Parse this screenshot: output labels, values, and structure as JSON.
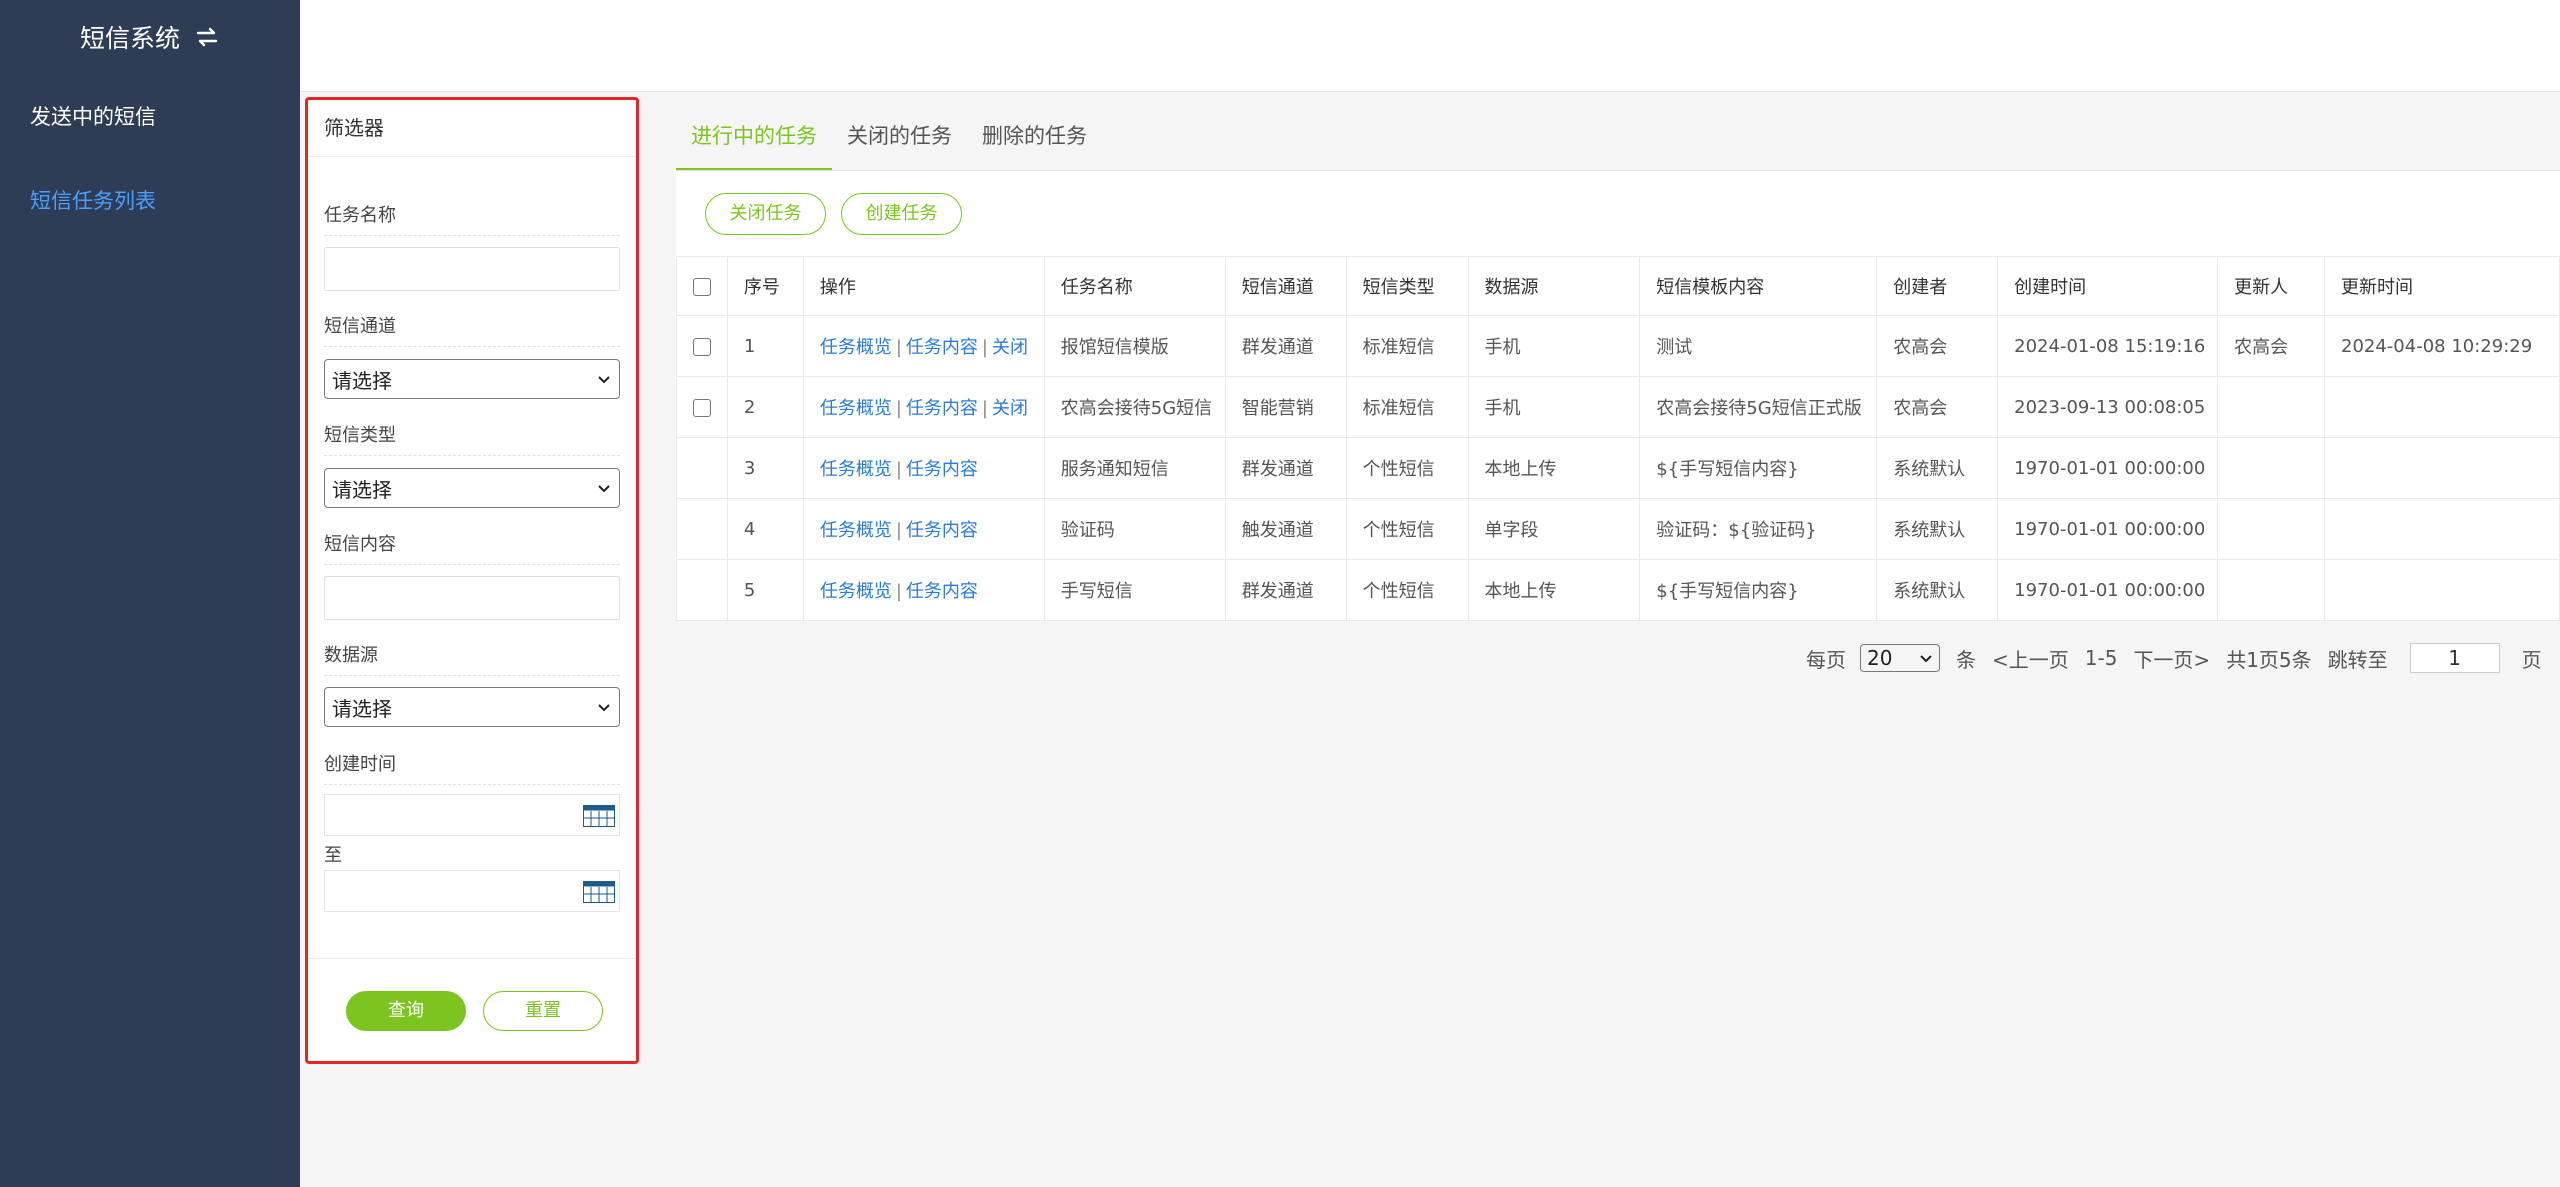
{
  "sidebar": {
    "brand_title": "短信系统",
    "items": [
      {
        "label": "发送中的短信"
      },
      {
        "label": "短信任务列表"
      }
    ]
  },
  "filter": {
    "title": "筛选器",
    "task_name_label": "任务名称",
    "channel_label": "短信通道",
    "channel_value": "请选择",
    "type_label": "短信类型",
    "type_value": "请选择",
    "content_label": "短信内容",
    "source_label": "数据源",
    "source_value": "请选择",
    "created_label": "创建时间",
    "to_label": "至",
    "query_label": "查询",
    "reset_label": "重置"
  },
  "tabs": [
    {
      "label": "进行中的任务"
    },
    {
      "label": "关闭的任务"
    },
    {
      "label": "删除的任务"
    }
  ],
  "toolbar": {
    "close_task_label": "关闭任务",
    "create_task_label": "创建任务"
  },
  "table": {
    "headers": [
      "序号",
      "操作",
      "任务名称",
      "短信通道",
      "短信类型",
      "数据源",
      "短信模板内容",
      "创建者",
      "创建时间",
      "更新人",
      "更新时间"
    ],
    "op_overview": "任务概览",
    "op_content": "任务内容",
    "op_close": "关闭",
    "op_sep": "|",
    "rows": [
      {
        "no": "1",
        "name": "报馆短信模版",
        "channel": "群发通道",
        "type": "标准短信",
        "source": "手机",
        "template": "测试",
        "creator": "农高会",
        "created": "2024-01-08 15:19:16",
        "updater": "农高会",
        "updated": "2024-04-08 10:29:29"
      },
      {
        "no": "2",
        "name": "农高会接待5G短信",
        "channel": "智能营销",
        "type": "标准短信",
        "source": "手机",
        "template": "农高会接待5G短信正式版",
        "creator": "农高会",
        "created": "2023-09-13 00:08:05",
        "updater": "",
        "updated": ""
      },
      {
        "no": "3",
        "name": "服务通知短信",
        "channel": "群发通道",
        "type": "个性短信",
        "source": "本地上传",
        "template": "${手写短信内容}",
        "creator": "系统默认",
        "created": "1970-01-01 00:00:00",
        "updater": "",
        "updated": ""
      },
      {
        "no": "4",
        "name": "验证码",
        "channel": "触发通道",
        "type": "个性短信",
        "source": "单字段",
        "template": "验证码：${验证码}",
        "creator": "系统默认",
        "created": "1970-01-01 00:00:00",
        "updater": "",
        "updated": ""
      },
      {
        "no": "5",
        "name": "手写短信",
        "channel": "群发通道",
        "type": "个性短信",
        "source": "本地上传",
        "template": "${手写短信内容}",
        "creator": "系统默认",
        "created": "1970-01-01 00:00:00",
        "updater": "",
        "updated": ""
      }
    ]
  },
  "pager": {
    "per_page_label": "每页",
    "per_page_value": "20",
    "unit_label": "条",
    "prev_label": "<上一页",
    "range_label": "1-5",
    "next_label": "下一页>",
    "total_label": "共1页5条",
    "jump_label": "跳转至",
    "jump_value": "1",
    "page_label": "页"
  },
  "colors": {
    "sidebar_bg": "#2e3d55",
    "accent_green": "#7cc520",
    "link_blue": "#2b7bd8",
    "highlight_red": "#e42626"
  }
}
